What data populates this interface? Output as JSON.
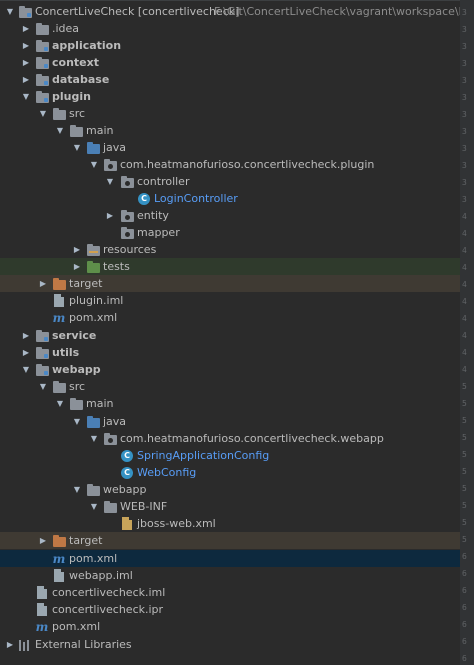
{
  "root": {
    "name": "ConcertLiveCheck [concertlivecheck]",
    "path": "F:\\Git\\ConcertLiveCheck\\vagrant\\workspace\\backend"
  },
  "nodes": {
    "idea": ".idea",
    "application": "application",
    "context": "context",
    "database": "database",
    "plugin": "plugin",
    "plugin_src": "src",
    "plugin_main": "main",
    "plugin_java": "java",
    "plugin_pkg": "com.heatmanofurioso.concertlivecheck.plugin",
    "controller": "controller",
    "login_controller": "LoginController",
    "entity": "entity",
    "mapper": "mapper",
    "resources": "resources",
    "tests": "tests",
    "plugin_target": "target",
    "plugin_iml": "plugin.iml",
    "plugin_pom": "pom.xml",
    "service": "service",
    "utils": "utils",
    "webapp": "webapp",
    "webapp_src": "src",
    "webapp_main": "main",
    "webapp_java": "java",
    "webapp_pkg": "com.heatmanofurioso.concertlivecheck.webapp",
    "spring_config": "SpringApplicationConfig",
    "web_config": "WebConfig",
    "webapp_folder": "webapp",
    "web_inf": "WEB-INF",
    "jboss_web": "jboss-web.xml",
    "webapp_target": "target",
    "webapp_pom": "pom.xml",
    "webapp_iml": "webapp.iml",
    "root_iml": "concertlivecheck.iml",
    "root_ipr": "concertlivecheck.ipr",
    "root_pom": "pom.xml",
    "external_libraries": "External Libraries"
  },
  "gutter_numbers": [
    "3",
    "3",
    "3",
    "3",
    "3",
    "3",
    "3",
    "3",
    "3",
    "3",
    "3",
    "3",
    "4",
    "4",
    "4",
    "4",
    "4",
    "4",
    "4",
    "4",
    "4",
    "4",
    "5",
    "5",
    "5",
    "5",
    "5",
    "5",
    "5",
    "5",
    "5",
    "5",
    "6",
    "6",
    "6",
    "6",
    "6",
    "6",
    "6"
  ],
  "colors": {
    "background": "#2b2b2b",
    "selection": "#0d293e",
    "tests_highlight": "#2f3a2c",
    "target_highlight": "#3f3a33",
    "class_icon": "#3592c4",
    "maven_icon": "#4a88c7"
  }
}
